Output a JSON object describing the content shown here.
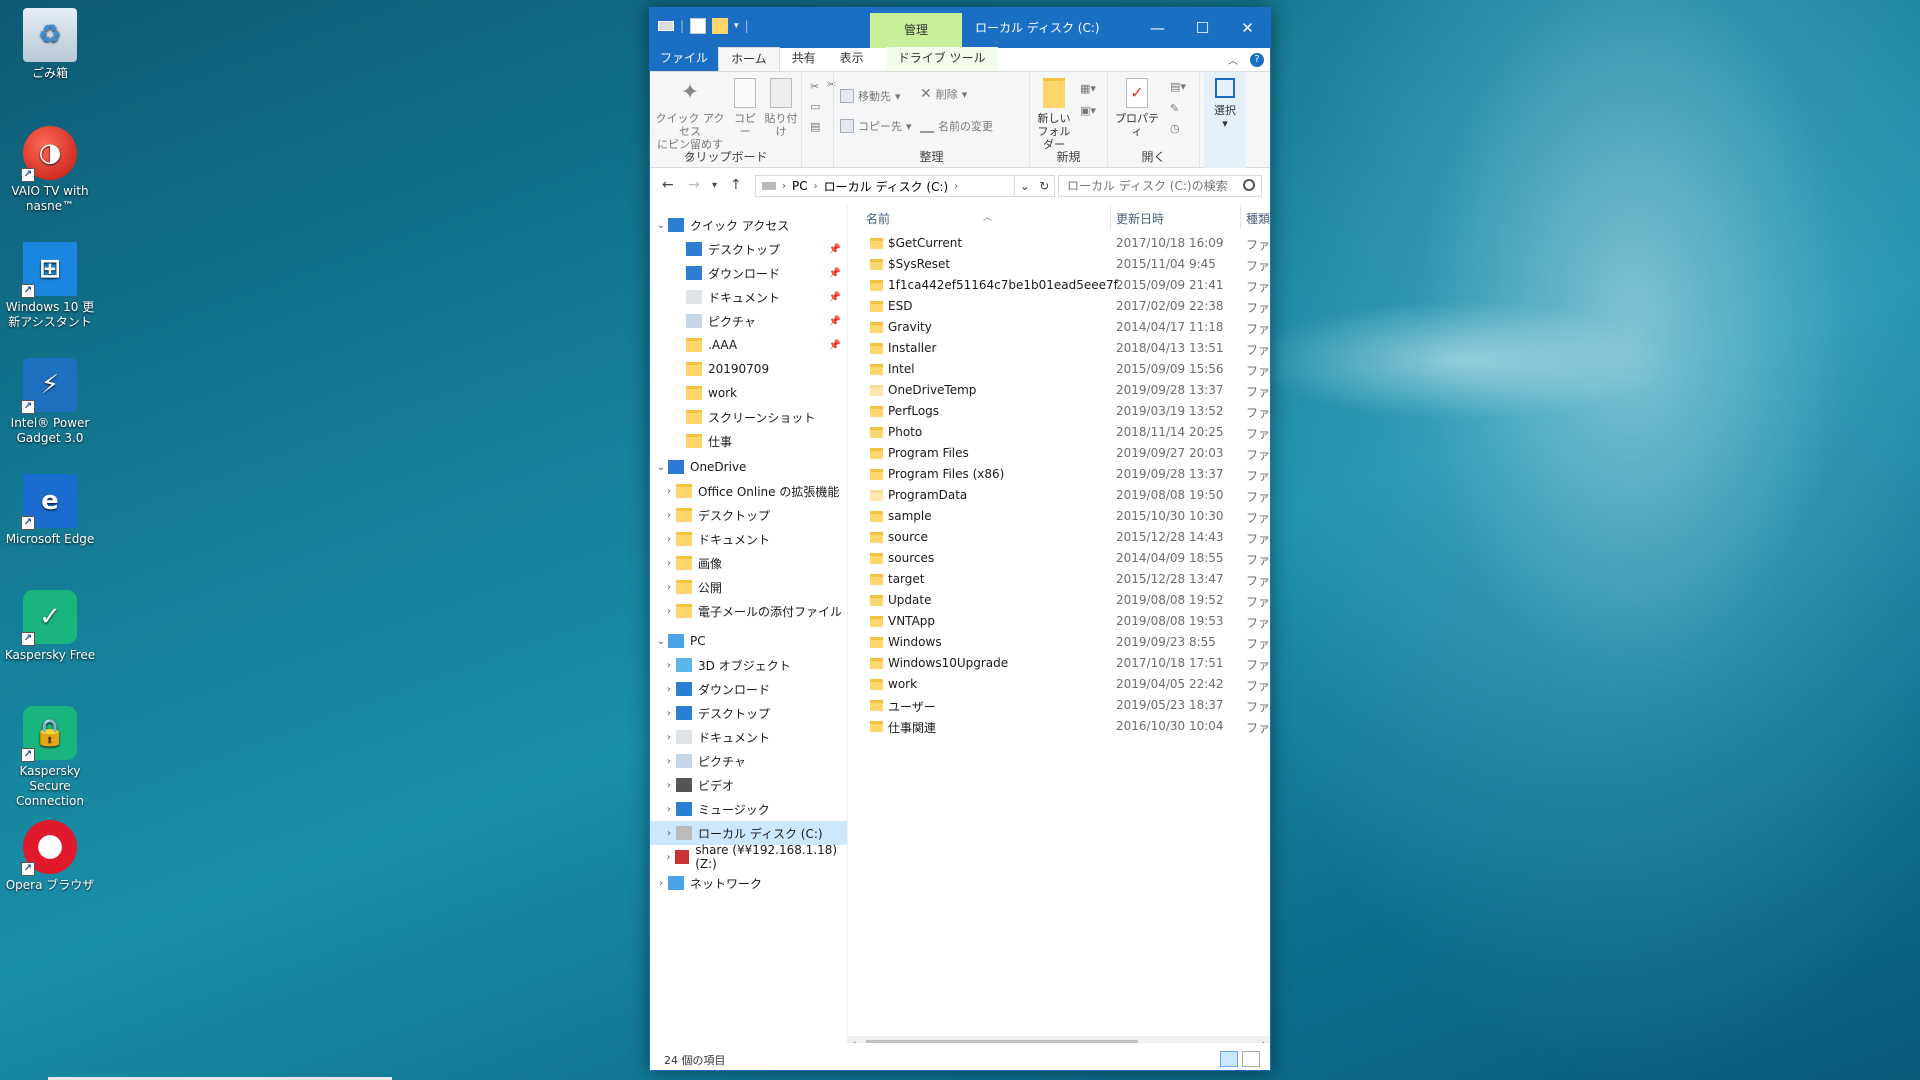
{
  "desktop": {
    "icons": [
      {
        "label": "ごみ箱",
        "icon": "recycle-bin-icon"
      },
      {
        "label": "VAIO TV with nasne™",
        "icon": "vaio-tv-icon"
      },
      {
        "label": "Windows 10 更新アシスタント",
        "icon": "windows-update-icon"
      },
      {
        "label": "Intel® Power Gadget 3.0",
        "icon": "intel-power-gadget-icon"
      },
      {
        "label": "Microsoft Edge",
        "icon": "edge-icon"
      },
      {
        "label": "Kaspersky Free",
        "icon": "kaspersky-free-icon"
      },
      {
        "label": "Kaspersky Secure Connection",
        "icon": "kaspersky-secure-icon"
      },
      {
        "label": "Opera ブラウザ",
        "icon": "opera-icon"
      }
    ]
  },
  "window": {
    "title": "ローカル ディスク (C:)",
    "manage_tab": "管理",
    "controls": {
      "minimize": "—",
      "maximize": "☐",
      "close": "✕"
    }
  },
  "ribbon_tabs": {
    "file": "ファイル",
    "home": "ホーム",
    "share": "共有",
    "view": "表示",
    "drive_tools": "ドライブ ツール"
  },
  "ribbon": {
    "clipboard": {
      "label": "クリップボード",
      "pin_line1": "クイック アクセス",
      "pin_line2": "にピン留めする",
      "copy": "コピー",
      "paste": "貼り付け"
    },
    "organize": {
      "label": "整理",
      "move_to": "移動先",
      "copy_to": "コピー先",
      "delete": "削除",
      "rename": "名前の変更"
    },
    "new": {
      "label": "新規",
      "new_folder_line1": "新しい",
      "new_folder_line2": "フォルダー"
    },
    "open": {
      "label": "開く",
      "properties": "プロパティ"
    },
    "select": {
      "label": "選択"
    }
  },
  "address": {
    "crumbs": [
      "PC",
      "ローカル ディスク (C:)"
    ],
    "search_placeholder": "ローカル ディスク (C:)の検索"
  },
  "nav": {
    "quick_access": "クイック アクセス",
    "quick_items": [
      "デスクトップ",
      "ダウンロード",
      "ドキュメント",
      "ピクチャ",
      ".AAA",
      "20190709",
      "work",
      "スクリーンショット",
      "仕事"
    ],
    "onedrive": "OneDrive",
    "onedrive_items": [
      "Office Online の拡張機能",
      "デスクトップ",
      "ドキュメント",
      "画像",
      "公開",
      "電子メールの添付ファイル"
    ],
    "pc": "PC",
    "pc_items": [
      "3D オブジェクト",
      "ダウンロード",
      "デスクトップ",
      "ドキュメント",
      "ピクチャ",
      "ビデオ",
      "ミュージック",
      "ローカル ディスク (C:)",
      "share (¥¥192.168.1.18) (Z:)"
    ],
    "network": "ネットワーク"
  },
  "columns": {
    "name": "名前",
    "modified": "更新日時",
    "type": "種類"
  },
  "files": [
    {
      "name": "$GetCurrent",
      "date": "2017/10/18 16:09",
      "type": "ファイ"
    },
    {
      "name": "$SysReset",
      "date": "2015/11/04 9:45",
      "type": "ファイ"
    },
    {
      "name": "1f1ca442ef51164c7be1b01ead5eee7f",
      "date": "2015/09/09 21:41",
      "type": "ファイ"
    },
    {
      "name": "ESD",
      "date": "2017/02/09 22:38",
      "type": "ファイ"
    },
    {
      "name": "Gravity",
      "date": "2014/04/17 11:18",
      "type": "ファイ"
    },
    {
      "name": "Installer",
      "date": "2018/04/13 13:51",
      "type": "ファイ"
    },
    {
      "name": "Intel",
      "date": "2015/09/09 15:56",
      "type": "ファイ"
    },
    {
      "name": "OneDriveTemp",
      "date": "2019/09/28 13:37",
      "type": "ファイ"
    },
    {
      "name": "PerfLogs",
      "date": "2019/03/19 13:52",
      "type": "ファイ"
    },
    {
      "name": "Photo",
      "date": "2018/11/14 20:25",
      "type": "ファイ"
    },
    {
      "name": "Program Files",
      "date": "2019/09/27 20:03",
      "type": "ファイ"
    },
    {
      "name": "Program Files (x86)",
      "date": "2019/09/28 13:37",
      "type": "ファイ"
    },
    {
      "name": "ProgramData",
      "date": "2019/08/08 19:50",
      "type": "ファイ"
    },
    {
      "name": "sample",
      "date": "2015/10/30 10:30",
      "type": "ファイ"
    },
    {
      "name": "source",
      "date": "2015/12/28 14:43",
      "type": "ファイ"
    },
    {
      "name": "sources",
      "date": "2014/04/09 18:55",
      "type": "ファイ"
    },
    {
      "name": "target",
      "date": "2015/12/28 13:47",
      "type": "ファイ"
    },
    {
      "name": "Update",
      "date": "2019/08/08 19:52",
      "type": "ファイ"
    },
    {
      "name": "VNTApp",
      "date": "2019/08/08 19:53",
      "type": "ファイ"
    },
    {
      "name": "Windows",
      "date": "2019/09/23 8:55",
      "type": "ファイ"
    },
    {
      "name": "Windows10Upgrade",
      "date": "2017/10/18 17:51",
      "type": "ファイ"
    },
    {
      "name": "work",
      "date": "2019/04/05 22:42",
      "type": "ファイ"
    },
    {
      "name": "ユーザー",
      "date": "2019/05/23 18:37",
      "type": "ファイ"
    },
    {
      "name": "仕事関連",
      "date": "2016/10/30 10:04",
      "type": "ファイ"
    }
  ],
  "status": {
    "item_count": "24 個の項目"
  },
  "colors": {
    "accent": "#1a6fc5",
    "manage_tab": "#c9ef9b",
    "selected": "#cce8ff",
    "folder": "#ffd66b"
  }
}
